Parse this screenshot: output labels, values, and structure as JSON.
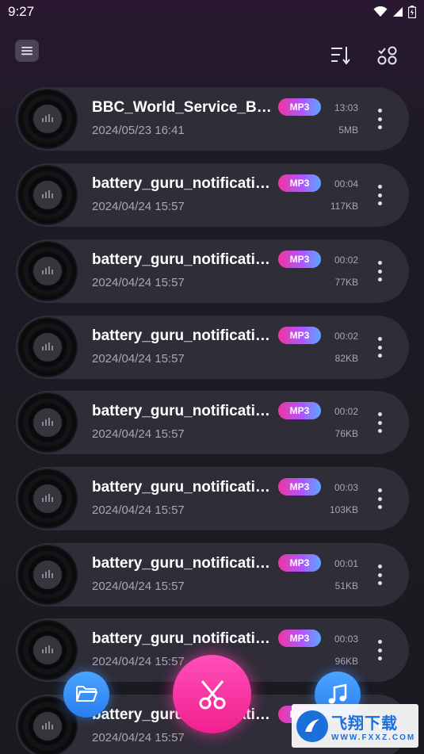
{
  "status_bar": {
    "time": "9:27",
    "icons": [
      "wifi-icon",
      "signal-icon",
      "battery-icon"
    ]
  },
  "toolbar": {
    "menu_icon": "menu-icon",
    "sort_icon": "sort-icon",
    "select_icon": "multi-select-icon"
  },
  "items": [
    {
      "title": "BBC_World_Service_BBC",
      "date": "2024/05/23 16:41",
      "format": "MP3",
      "duration": "13:03",
      "size": "5MB"
    },
    {
      "title": "battery_guru_notification",
      "date": "2024/04/24 15:57",
      "format": "MP3",
      "duration": "00:04",
      "size": "117KB"
    },
    {
      "title": "battery_guru_notification",
      "date": "2024/04/24 15:57",
      "format": "MP3",
      "duration": "00:02",
      "size": "77KB"
    },
    {
      "title": "battery_guru_notification",
      "date": "2024/04/24 15:57",
      "format": "MP3",
      "duration": "00:02",
      "size": "82KB"
    },
    {
      "title": "battery_guru_notification",
      "date": "2024/04/24 15:57",
      "format": "MP3",
      "duration": "00:02",
      "size": "76KB"
    },
    {
      "title": "battery_guru_notification",
      "date": "2024/04/24 15:57",
      "format": "MP3",
      "duration": "00:03",
      "size": "103KB"
    },
    {
      "title": "battery_guru_notification",
      "date": "2024/04/24 15:57",
      "format": "MP3",
      "duration": "00:01",
      "size": "51KB"
    },
    {
      "title": "battery_guru_notification",
      "date": "2024/04/24 15:57",
      "format": "MP3",
      "duration": "00:03",
      "size": "96KB"
    },
    {
      "title": "battery_guru_notification",
      "date": "2024/04/24 15:57",
      "format": "MP3",
      "duration": "",
      "size": ""
    }
  ],
  "fabs": {
    "folder_icon": "folder-icon",
    "cut_icon": "scissors-icon",
    "music_icon": "music-note-icon"
  },
  "watermark": {
    "cn": "飞翔下载",
    "en": "WWW.FXXZ.COM"
  },
  "colors": {
    "accent_pink": "#f0208f",
    "accent_blue": "#2b7df0",
    "card_bg": "#2e2d38"
  }
}
